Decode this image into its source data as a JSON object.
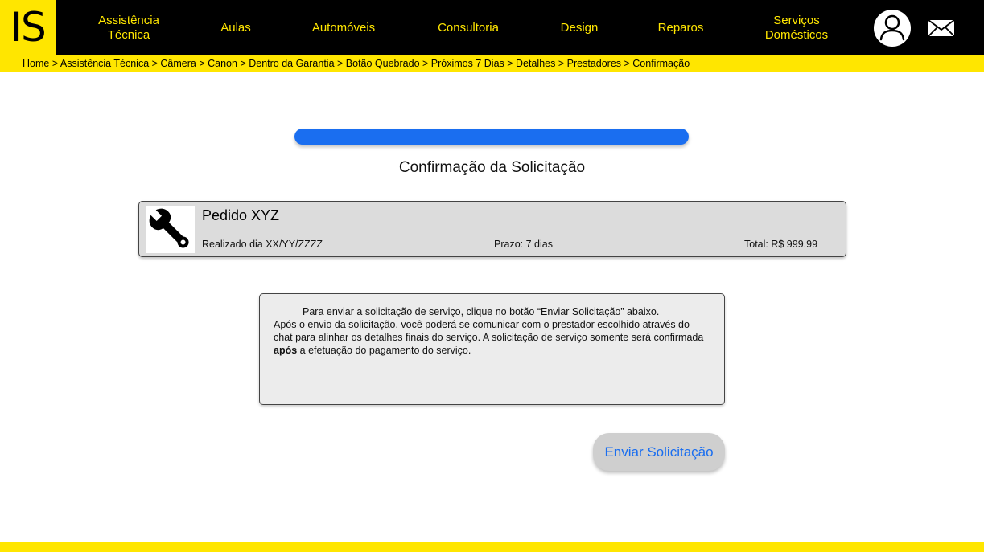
{
  "logo": {
    "text": "IS"
  },
  "nav": {
    "items": [
      {
        "line1": "Assistência",
        "line2": "Técnica"
      },
      {
        "line1": "Aulas",
        "line2": ""
      },
      {
        "line1": "Automóveis",
        "line2": ""
      },
      {
        "line1": "Consultoria",
        "line2": ""
      },
      {
        "line1": "Design",
        "line2": ""
      },
      {
        "line1": "Reparos",
        "line2": ""
      },
      {
        "line1": "Serviços",
        "line2": "Domésticos"
      }
    ]
  },
  "breadcrumb": {
    "items": [
      "Home",
      "Assistência Técnica",
      "Câmera",
      "Canon",
      "Dentro da Garantia",
      "Botão Quebrado",
      "Próximos 7 Dias",
      "Detalhes",
      "Prestadores",
      "Confirmação"
    ],
    "separator": " > "
  },
  "progress": {
    "value": 1.0
  },
  "page": {
    "title": "Confirmação da Solicitação"
  },
  "order": {
    "title": "Pedido XYZ",
    "date": "Realizado dia XX/YY/ZZZZ",
    "deadline": "Prazo: 7 dias",
    "total": "Total: R$ 999.99"
  },
  "info": {
    "line1": "Para enviar a solicitação de serviço, clique no botão “Enviar Solicitação” abaixo.",
    "text_before_bold": "Após o envio da solicitação, você poderá se comunicar com o prestador escolhido através do chat para alinhar os detalhes finais do serviço. A solicitação de serviço somente será confirmada ",
    "bold": "após",
    "text_after_bold": " a efetuação do pagamento do serviço."
  },
  "actions": {
    "submit_label": "Enviar Solicitação"
  },
  "colors": {
    "accent": "#ffe600",
    "primary": "#1a6ef0",
    "nav_bg": "#000000"
  },
  "icons": {
    "user": "user-icon",
    "mail": "mail-icon",
    "order": "wrench-icon"
  }
}
